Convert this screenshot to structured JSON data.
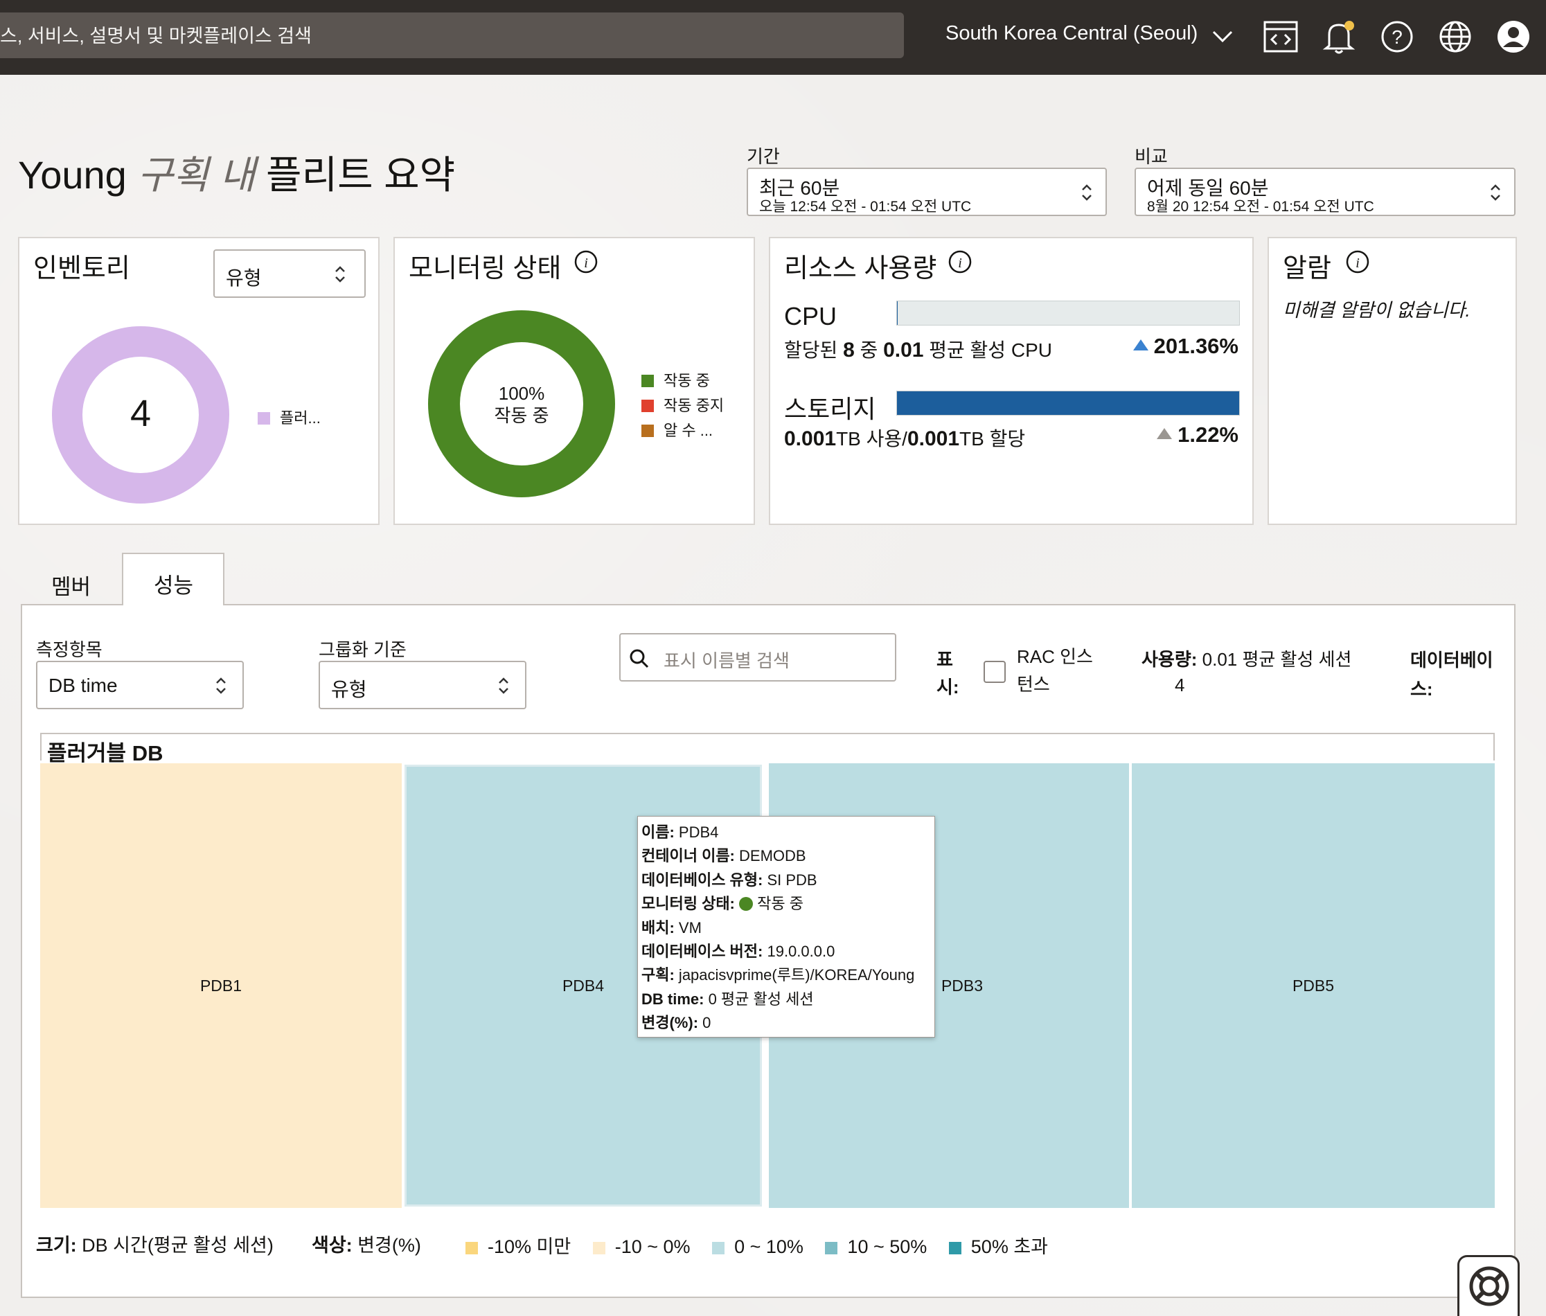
{
  "topbar": {
    "search_placeholder": "스, 서비스, 설명서 및 마켓플레이스 검색",
    "region": "South Korea Central (Seoul)"
  },
  "header": {
    "title_prefix": "Young ",
    "title_italic": "구획 내",
    "title_suffix": " 플리트 요약",
    "period_label": "기간",
    "period_value": "최근 60분",
    "period_range": "오늘 12:54 오전 - 01:54 오전 UTC",
    "compare_label": "비교",
    "compare_value": "어제 동일 60분",
    "compare_range": "8월 20 12:54 오전 - 01:54 오전 UTC"
  },
  "inventory": {
    "title": "인벤토리",
    "select_value": "유형",
    "count": "4",
    "legend": "플러...",
    "color": "#d6b7ea"
  },
  "monitoring": {
    "title": "모니터링 상태",
    "center_pct": "100%",
    "center_label": "작동 중",
    "legend": [
      {
        "label": "작동 중",
        "color": "#4b8723"
      },
      {
        "label": "작동 중지",
        "color": "#e0402e"
      },
      {
        "label": "알 수 ...",
        "color": "#b86f1e"
      }
    ]
  },
  "resource": {
    "title": "리소스 사용량",
    "cpu_label": "CPU",
    "cpu_fill": 0.0013,
    "cpu_detail_a": "할당된 ",
    "cpu_detail_b": "8",
    "cpu_detail_c": " 중 ",
    "cpu_detail_d": "0.01",
    "cpu_detail_e": " 평균 활성 CPU",
    "cpu_change": "201.36%",
    "storage_label": "스토리지",
    "storage_fill": 1.0,
    "storage_used": "0.001",
    "storage_used_unit": "TB 사용/",
    "storage_alloc": "0.001",
    "storage_alloc_unit": "TB 할당",
    "storage_change": "1.22%"
  },
  "alarms": {
    "title": "알람",
    "message": "미해결 알람이 없습니다."
  },
  "tabs": {
    "members": "멤버",
    "performance": "성능"
  },
  "performance": {
    "metric_label": "측정항목",
    "metric_value": "DB time",
    "group_label": "그룹화 기준",
    "group_value": "유형",
    "search_placeholder": "표시 이름별 검색",
    "show_label": "표시:",
    "rac_label": "RAC 인스턴스",
    "usage_label": "사용량:",
    "usage_value": "0.01 평균 활성 세션",
    "db_label": "데이터베이스:",
    "db_value": "4",
    "treemap_title": "플러거블 DB",
    "cells": [
      {
        "name": "PDB1",
        "color": "#fdebcb"
      },
      {
        "name": "PDB4",
        "color": "#bbdde2"
      },
      {
        "name": "PDB3",
        "color": "#bbdde2"
      },
      {
        "name": "PDB5",
        "color": "#bbdde2"
      }
    ],
    "tooltip": [
      {
        "k": "이름:",
        "v": " PDB4"
      },
      {
        "k": "컨테이너 이름:",
        "v": " DEMODB"
      },
      {
        "k": "데이터베이스 유형:",
        "v": " SI PDB"
      },
      {
        "k": "모니터링 상태:",
        "v": " 작동 중"
      },
      {
        "k": "배치:",
        "v": " VM"
      },
      {
        "k": "데이터베이스 버전:",
        "v": " 19.0.0.0.0"
      },
      {
        "k": "구획:",
        "v": " japacisvprime(루트)/KOREA/Young"
      },
      {
        "k": "DB time:",
        "v": " 0 평균 활성 세션"
      },
      {
        "k": "변경(%):",
        "v": " 0"
      }
    ],
    "size_label": "크기:",
    "size_value": " DB 시간(평균 활성 세션)",
    "color_label": "색상:",
    "color_value": " 변경(%)",
    "color_legend": [
      {
        "label": "-10% 미만",
        "color": "#fad67d"
      },
      {
        "label": "-10 ~ 0%",
        "color": "#fdebcb"
      },
      {
        "label": "0 ~ 10%",
        "color": "#bbdde2"
      },
      {
        "label": "10 ~ 50%",
        "color": "#7cbcc5"
      },
      {
        "label": "50% 초과",
        "color": "#2f9aa8"
      }
    ]
  }
}
